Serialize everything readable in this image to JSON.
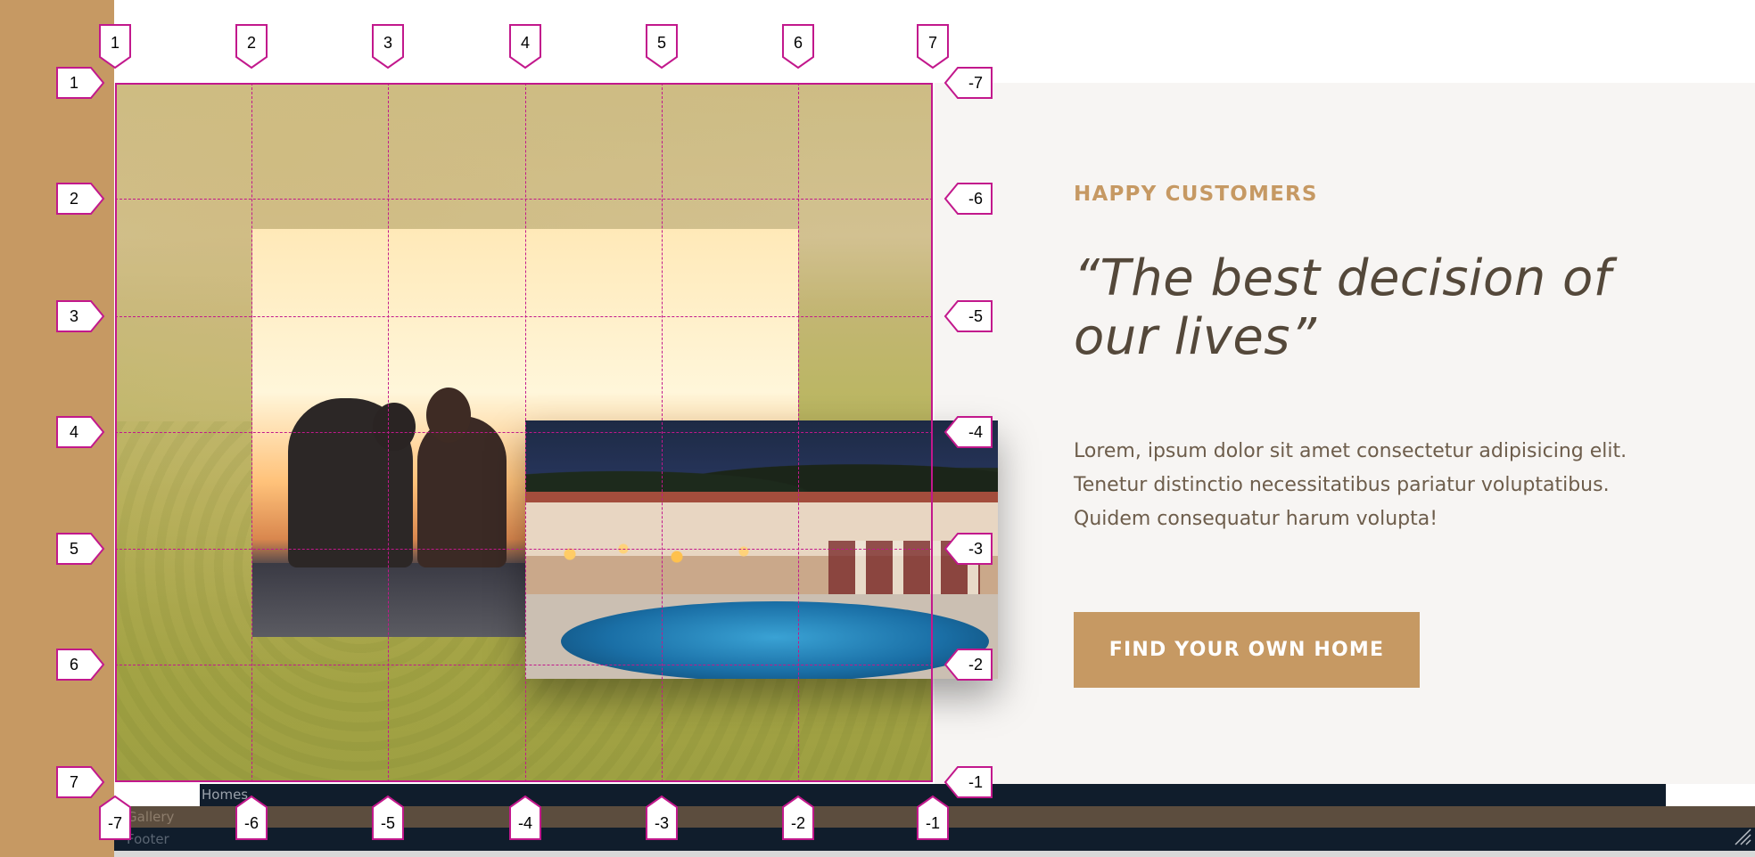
{
  "section": {
    "eyebrow": "HAPPY CUSTOMERS",
    "quote": "“The best decision of our lives”",
    "body": "Lorem, ipsum dolor sit amet consectetur adipisicing elit. Tenetur distinctio necessitatibus pariatur voluptatibus. Quidem consequatur harum volupta!",
    "cta_label": "FIND YOUR OWN HOME"
  },
  "grid_labels": {
    "columns_top": [
      "1",
      "2",
      "3",
      "4",
      "5",
      "6",
      "7"
    ],
    "columns_bottom": [
      "-7",
      "-6",
      "-5",
      "-4",
      "-3",
      "-2",
      "-1"
    ],
    "rows_left": [
      "1",
      "2",
      "3",
      "4",
      "5",
      "6",
      "7"
    ],
    "rows_right": [
      "-7",
      "-6",
      "-5",
      "-4",
      "-3",
      "-2",
      "-1"
    ]
  },
  "bottom_bars": {
    "homes": "Homes",
    "gallery": "Gallery",
    "footer": "Footer"
  },
  "colors": {
    "accent": "#c69963",
    "grid_line": "#c2188c",
    "navy": "#101d2c",
    "brown": "#5c4d3e",
    "text_dark": "#54483a"
  }
}
